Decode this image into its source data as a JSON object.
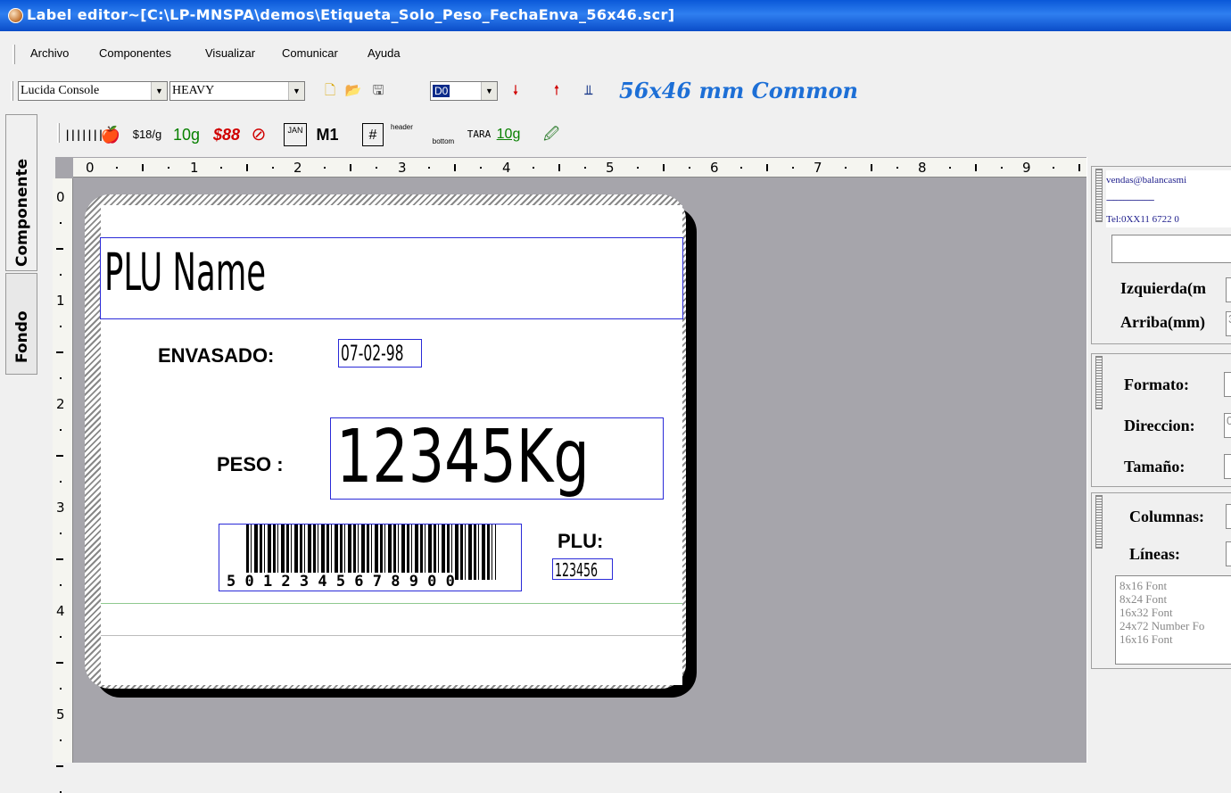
{
  "window": {
    "title": "Label editor~[C:\\LP-MNSPA\\demos\\Etiqueta_Solo_Peso_FechaEnva_56x46.scr]"
  },
  "menu": {
    "items": [
      "Archivo",
      "Componentes",
      "Visualizar",
      "Comunicar",
      "Ayuda"
    ]
  },
  "toolbar": {
    "font_name": "Lucida Console",
    "font_weight": "HEAVY",
    "dir_value": "D0",
    "label_format": "56x46 mm Common"
  },
  "tabs": {
    "component": "Componente",
    "background": "Fondo"
  },
  "components": {
    "price_per_kg": "$18/g",
    "weight_10g": "10g",
    "price_88": "$88",
    "jan": "JAN",
    "m1": "M1",
    "header": "header",
    "bottom": "bottom",
    "tara": "TARA",
    "tara_10g": "10g"
  },
  "rulers": {
    "h": [
      "0",
      "1",
      "2",
      "3",
      "4",
      "5",
      "6",
      "7",
      "8",
      "9"
    ],
    "v": [
      "0",
      "1",
      "2",
      "3",
      "4",
      "5"
    ]
  },
  "label": {
    "plu_name": "PLU Name",
    "envasado_label": "ENVASADO:",
    "envasado_date": "07-02-98",
    "peso_label": "PESO :",
    "peso_value": "12345Kg",
    "barcode_digits": "5  0 1 2 3 4 5  6 7 8 9 0 0",
    "plu_label": "PLU:",
    "plu_value": "123456"
  },
  "panel": {
    "text_line1": "vendas@balancasmi",
    "text_line2": "--------------------",
    "text_line3": "Tel:0XX11 6722 0",
    "izquierda": "Izquierda(m",
    "arriba": "Arriba(mm)",
    "arriba_val": "3",
    "formato": "Formato:",
    "direccion": "Direccion:",
    "direccion_val": "0",
    "tamano": "Tamaño:",
    "columnas": "Columnas:",
    "lineas": "Líneas:",
    "fonts": [
      "8x16  Font",
      "8x24  Font",
      "16x32 Font",
      "24x72 Number Fo",
      "16x16 Font"
    ]
  },
  "colors": {
    "title_bar": "#0a58d8",
    "field_border": "#2a2ad8",
    "canvas_bg": "#a6a5ab",
    "format_text": "#1d6fd6"
  }
}
